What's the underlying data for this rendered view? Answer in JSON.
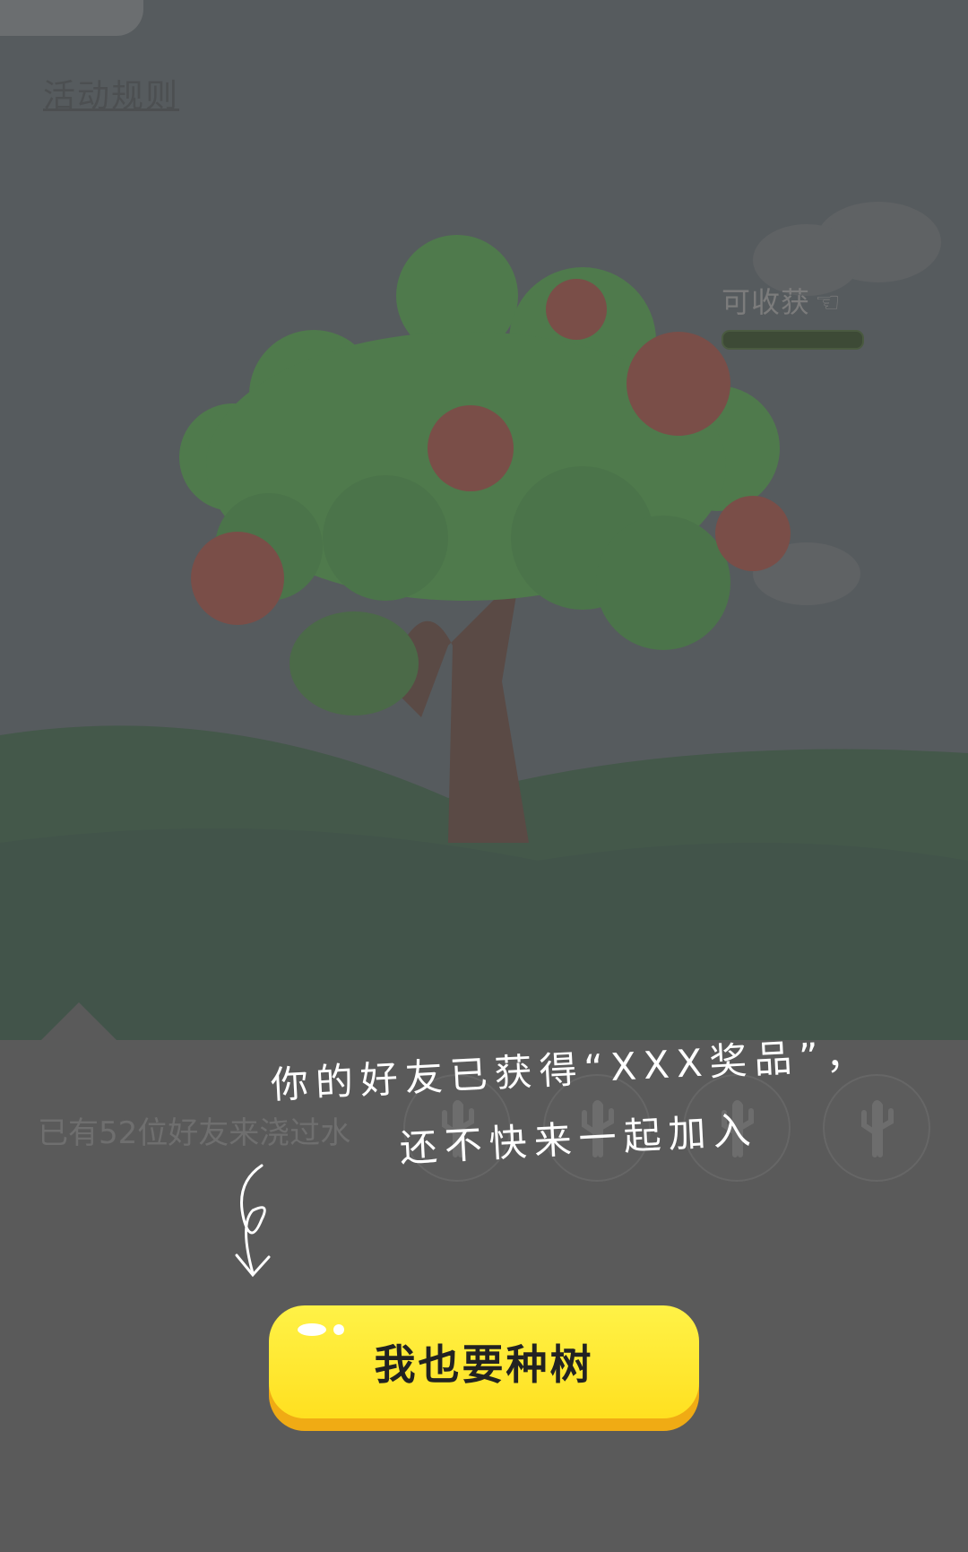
{
  "header": {
    "rules_link": "活动规则"
  },
  "tree_status": {
    "harvest_label": "可收获"
  },
  "friends": {
    "watered_text": "已有52位好友来浇过水",
    "avatar_count": 4
  },
  "message": {
    "line1": "你的好友已获得“XXX奖品”，",
    "line2": "还不快来一起加入"
  },
  "cta": {
    "label": "我也要种树"
  },
  "colors": {
    "overlay": "#5a5a5a",
    "button": "#ffe820",
    "button_shadow": "#f0ab14"
  },
  "icons": [
    "hand-pointing-icon",
    "cactus-icon",
    "curly-arrow-icon"
  ]
}
